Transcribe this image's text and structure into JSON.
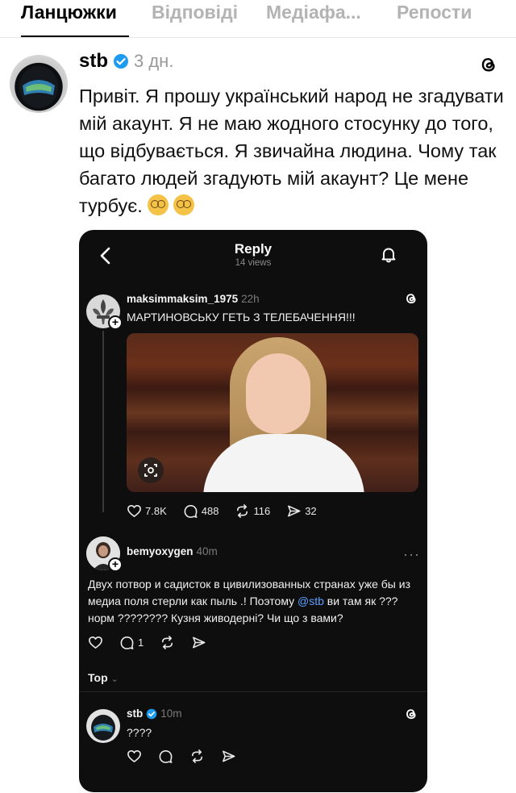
{
  "tabs": [
    {
      "label": "Ланцюжки",
      "active": true
    },
    {
      "label": "Відповіді",
      "active": false
    },
    {
      "label": "Медіафа...",
      "active": false
    },
    {
      "label": "Репости",
      "active": false
    }
  ],
  "post": {
    "username": "stb",
    "verified": true,
    "time": "3 дн.",
    "text": "Привіт. Я прошу український народ не згадувати мій акаунт. Я не маю жодного стосунку до того, що відбувається. Я звичайна людина. Чому так багато людей згадують мій акаунт? Це мене турбує."
  },
  "screenshot": {
    "header": {
      "title": "Reply",
      "views": "14 views"
    },
    "comment1": {
      "username": "maksimmaksim_1975",
      "time": "22h",
      "text": "МАРТИНОВСЬКУ ГЕТЬ З ТЕЛЕБАЧЕННЯ!!!",
      "likes": "7.8K",
      "replies": "488",
      "reposts": "116",
      "shares": "32"
    },
    "comment2": {
      "username": "bemyoxygen",
      "time": "40m",
      "text_before": "Двух потвор и садисток в цивилизованных странах уже бы из медиа поля стерли как пыль .! Поэтому ",
      "mention": "@stb",
      "text_after": " ви там як ???норм ???????? Кузня живодерні? Чи що з вами?",
      "replies": "1"
    },
    "sort_label": "Top",
    "comment3": {
      "username": "stb",
      "time": "10m",
      "text": "????"
    }
  },
  "colors": {
    "verified": "#1d9bf0",
    "mention": "#5aa0ff",
    "dark_bg": "#0e0e0e"
  },
  "icons": [
    "threads-icon",
    "back-chevron-icon",
    "bell-icon",
    "heart-icon",
    "comment-icon",
    "repost-icon",
    "share-icon",
    "more-icon",
    "dizzy-face-emoji"
  ]
}
